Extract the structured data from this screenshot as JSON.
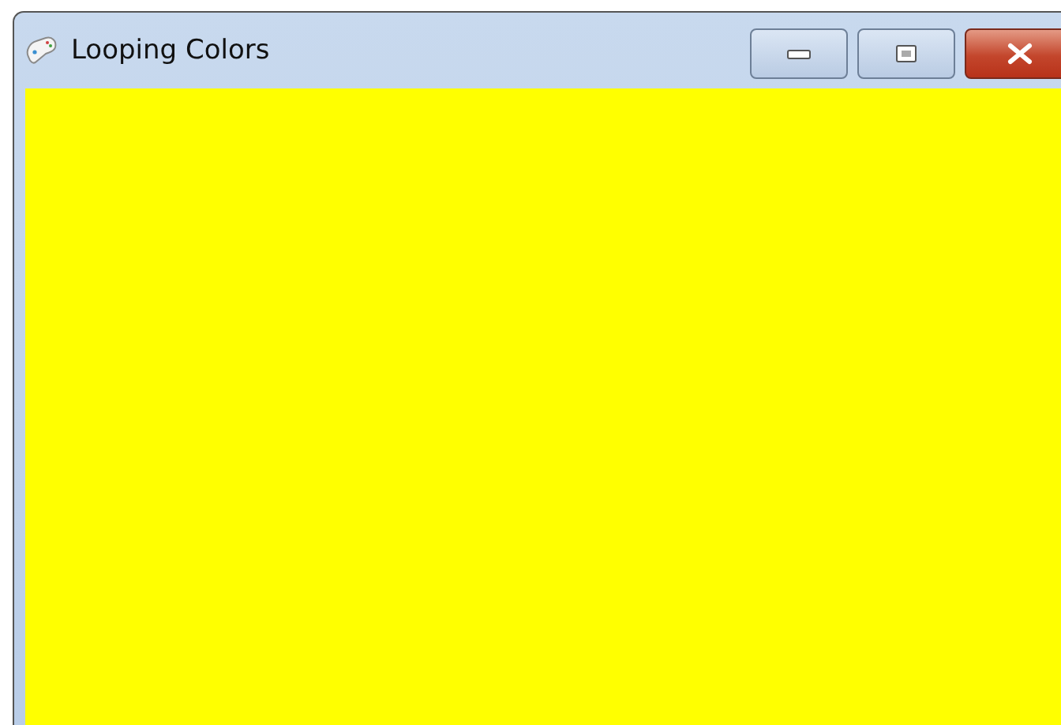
{
  "window": {
    "title": "Looping Colors"
  }
}
